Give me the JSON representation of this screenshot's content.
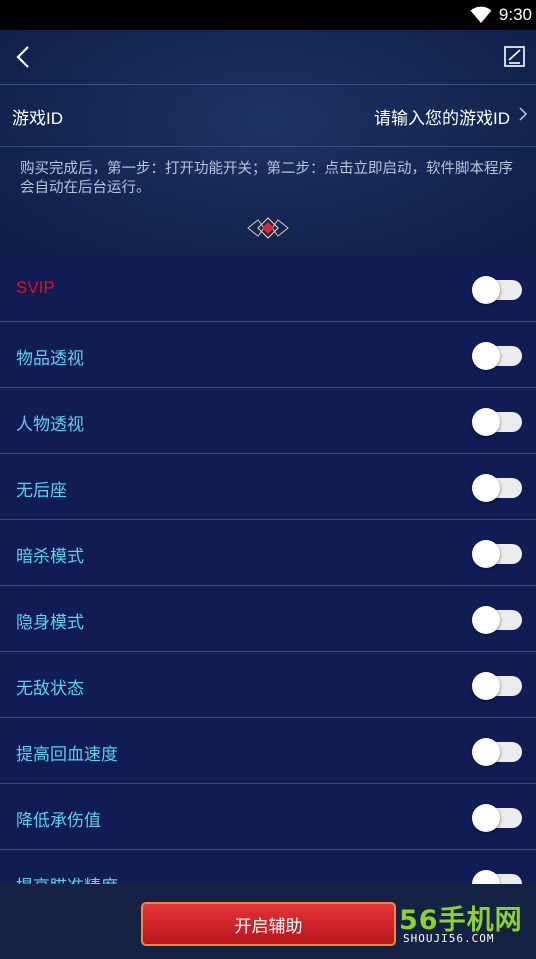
{
  "status_bar": {
    "time": "9:30"
  },
  "game_id": {
    "label": "游戏ID",
    "placeholder": "请输入您的游戏ID"
  },
  "notice": "购买完成后，第一步：打开功能开关；第二步：点击立即启动，软件脚本程序会自动在后台运行。",
  "features": [
    {
      "label": "SVIP",
      "enabled": false,
      "highlight": true
    },
    {
      "label": "物品透视",
      "enabled": false
    },
    {
      "label": "人物透视",
      "enabled": false
    },
    {
      "label": "无后座",
      "enabled": false
    },
    {
      "label": "暗杀模式",
      "enabled": false
    },
    {
      "label": "隐身模式",
      "enabled": false
    },
    {
      "label": "无敌状态",
      "enabled": false
    },
    {
      "label": "提高回血速度",
      "enabled": false
    },
    {
      "label": "降低承伤值",
      "enabled": false
    },
    {
      "label": "提高瞄准精度",
      "enabled": false
    }
  ],
  "start_button": "开启辅助",
  "watermark": {
    "brand": "56手机网",
    "domain": "SHOUJI56.COM"
  },
  "colors": {
    "feature_label": "#5ad2ee",
    "svip_label": "#d9141f",
    "background": "#111c55",
    "button": "#d4252b",
    "watermark": "#8bd42a"
  }
}
